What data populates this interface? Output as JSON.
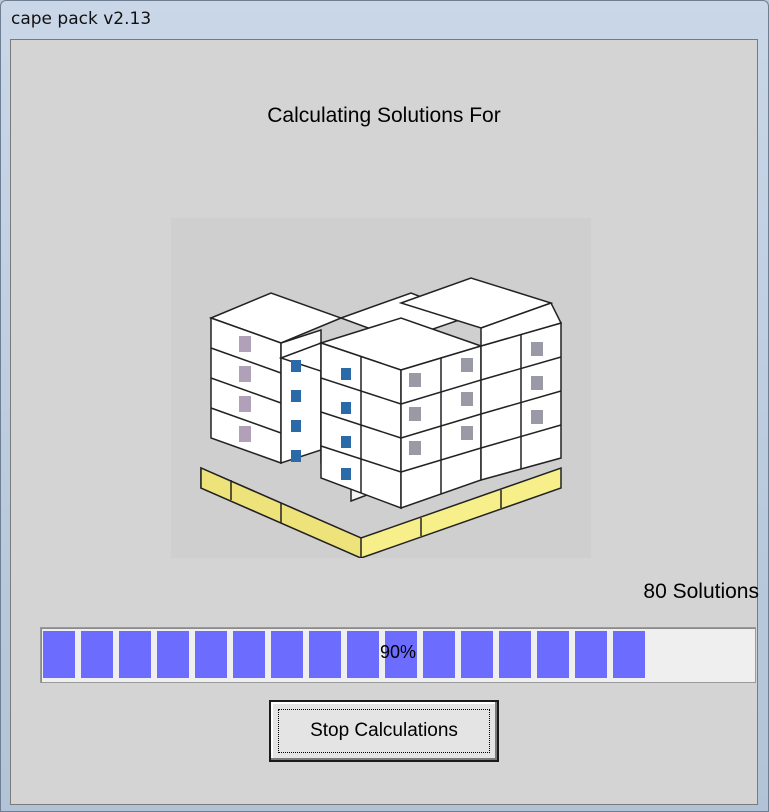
{
  "window": {
    "title": "cape pack v2.13"
  },
  "main": {
    "heading": "Calculating Solutions For",
    "solutions_count": "80 Solutions",
    "progress": {
      "value_percent": 90,
      "label": "90%"
    },
    "stop_button_label": "Stop Calculations"
  },
  "colors": {
    "progress_fill": "#6c6cff",
    "pallet": "#f7ef8a",
    "box": "#ffffff"
  }
}
